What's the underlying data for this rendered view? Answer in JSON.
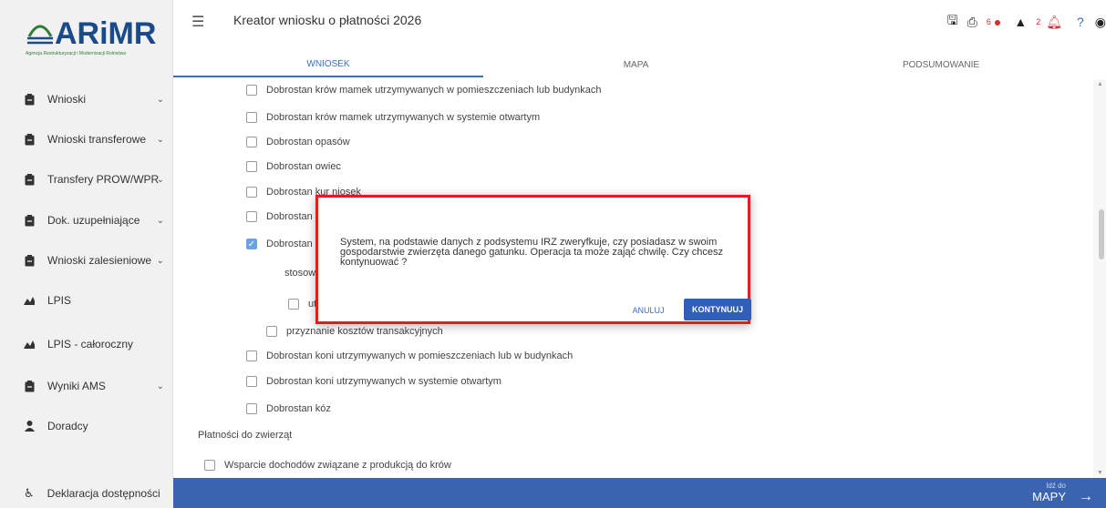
{
  "app": {
    "logo": "ARiMR",
    "logo_subtitle": "Agencja Restrukturyzacji i Modernizacji Rolnictwa",
    "title": "Kreator wniosku o płatności 2026"
  },
  "topbar": {
    "error_count": "6",
    "warning_count": "2"
  },
  "tabs": [
    {
      "label": "WNIOSEK"
    },
    {
      "label": "MAPA"
    },
    {
      "label": "PODSUMOWANIE"
    }
  ],
  "sidebar": {
    "items": [
      {
        "label": "Wnioski"
      },
      {
        "label": "Wnioski transferowe"
      },
      {
        "label": "Transfery PROW/WPR"
      },
      {
        "label": "Dok. uzupełniające"
      },
      {
        "label": "Wnioski zalesieniowe"
      },
      {
        "label": "LPIS"
      },
      {
        "label": "LPIS - całoroczny"
      },
      {
        "label": "Wyniki AMS"
      },
      {
        "label": "Doradcy"
      }
    ],
    "footer": "Deklaracja dostępności"
  },
  "content": {
    "items": [
      {
        "label": "Dobrostan krów mamek utrzymywanych w pomieszczeniach lub budynkach"
      },
      {
        "label": "Dobrostan krów mamek utrzymywanych w systemie otwartym"
      },
      {
        "label": "Dobrostan opasów"
      },
      {
        "label": "Dobrostan owiec"
      },
      {
        "label": "Dobrostan kur niosek"
      },
      {
        "label": "Dobrostan kurcząt br"
      },
      {
        "label": "Dobrostan indyków u"
      },
      {
        "label": "stosowanie prakty"
      },
      {
        "label": "utrzymanie"
      },
      {
        "label": "przyznanie kosztów transakcyjnych"
      },
      {
        "label": "Dobrostan koni utrzymywanych w pomieszczeniach lub w budynkach"
      },
      {
        "label": "Dobrostan koni utrzymywanych w systemie otwartym"
      },
      {
        "label": "Dobrostan kóz"
      },
      {
        "label": "Wsparcie dochodów związane z produkcją do krów"
      }
    ],
    "section_heading": "Płatności do zwierząt"
  },
  "bottombar": {
    "next_small": "Idź do",
    "next_label": "MAPY"
  },
  "modal": {
    "message": "System, na podstawie danych z podsystemu IRZ zweryfkuje, czy posiadasz w swoim gospodarstwie zwierzęta danego gatunku. Operacja ta może zająć chwilę. Czy chcesz kontynuować ?",
    "cancel_label": "ANULUJ",
    "continue_label": "KONTYNUUJ"
  },
  "colors": {
    "accent": "#3a6fc4",
    "bottombar": "#3a64b0",
    "modal_border": "#e01e1e",
    "error": "#d32f2f"
  }
}
